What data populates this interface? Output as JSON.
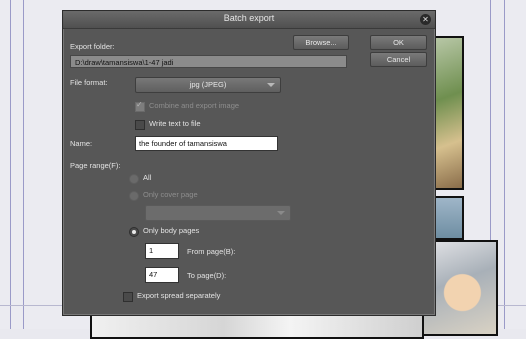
{
  "dialog": {
    "title": "Batch export",
    "close_icon": "close-icon",
    "export_folder_label": "Export folder:",
    "export_folder_path": "D:\\draw\\tamansiswa\\1-47 jadi",
    "browse_label": "Browse...",
    "ok_label": "OK",
    "cancel_label": "Cancel",
    "file_format_label": "File format:",
    "file_format_value": "jpg (JPEG)",
    "combine_label": "Combine and export image",
    "combine_checked": true,
    "write_text_label": "Write text to file",
    "write_text_checked": false,
    "name_label": "Name:",
    "name_value": "the founder of tamansiswa",
    "page_range_label": "Page range(F):",
    "range_all_label": "All",
    "range_cover_label": "Only cover page",
    "range_body_label": "Only body pages",
    "range_selected": "body",
    "from_value": "1",
    "from_label": "From page(B):",
    "to_value": "47",
    "to_label": "To page(D):",
    "export_spread_label": "Export spread separately",
    "export_spread_checked": false
  }
}
